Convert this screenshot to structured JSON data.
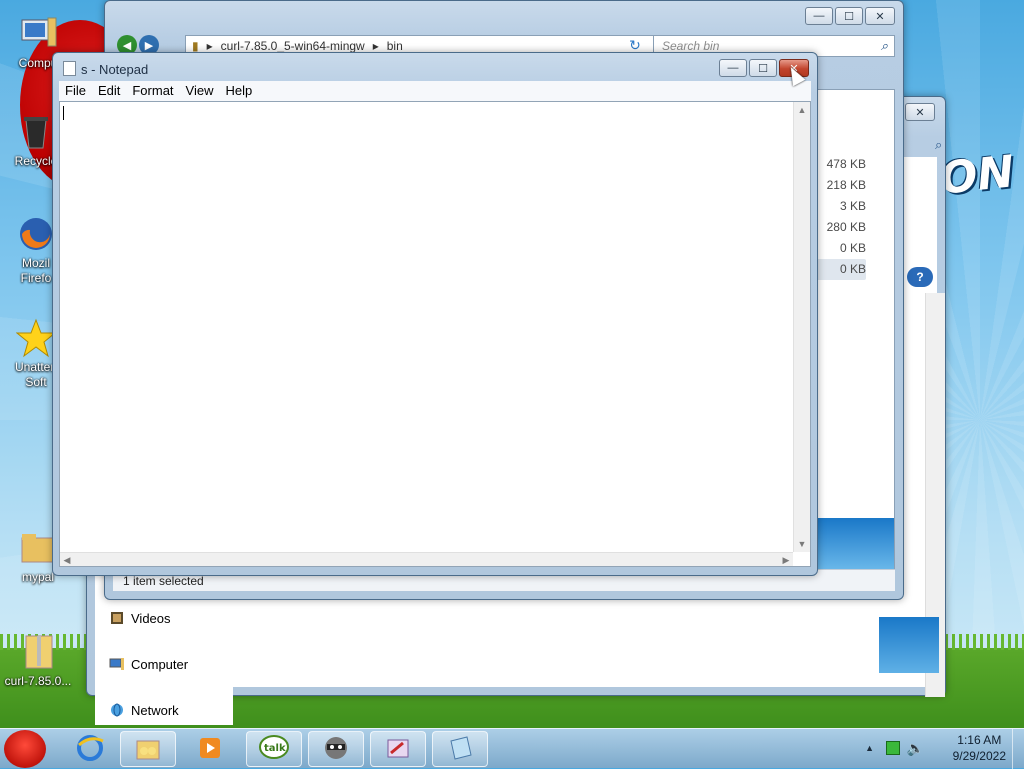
{
  "desktop": {
    "icons": [
      {
        "label": "Compu",
        "icon": "computer-icon"
      },
      {
        "label": "Recycle",
        "icon": "recycle-bin-icon"
      },
      {
        "label": "Mozil\nFirefo",
        "icon": "firefox-icon"
      },
      {
        "label": "Unatten\nSoft",
        "icon": "star-icon"
      },
      {
        "label": "mypal",
        "icon": "folder-icon"
      },
      {
        "label": "curl-7.85.0...",
        "icon": "zip-folder-icon"
      }
    ],
    "wallpaper_text": "ON"
  },
  "explorer": {
    "breadcrumb": [
      "curl-7.85.0_5-win64-mingw",
      "bin"
    ],
    "search_placeholder": "Search bin",
    "file_sizes": [
      "478 KB",
      "218 KB",
      "3 KB",
      "280 KB",
      "0 KB",
      "0 KB"
    ],
    "status": "1 item selected",
    "controls": {
      "minimize": "—",
      "maximize": "☐",
      "close": "✕"
    }
  },
  "explorer2": {
    "nav_items": [
      {
        "label": "Videos",
        "icon": "videos-icon"
      },
      {
        "label": "Computer",
        "icon": "computer-icon"
      },
      {
        "label": "Network",
        "icon": "network-icon"
      }
    ]
  },
  "notepad": {
    "title": "s - Notepad",
    "menu": [
      "File",
      "Edit",
      "Format",
      "View",
      "Help"
    ],
    "content": "",
    "controls": {
      "minimize": "—",
      "maximize": "☐",
      "close": "✕"
    }
  },
  "taskbar": {
    "buttons": [
      {
        "name": "internet-explorer-icon"
      },
      {
        "name": "windows-explorer-icon"
      },
      {
        "name": "media-player-icon"
      },
      {
        "name": "google-talk-icon"
      },
      {
        "name": "raccoon-app-icon"
      },
      {
        "name": "paint-app-icon"
      },
      {
        "name": "notepad-icon"
      }
    ],
    "clock": {
      "time": "1:16 AM",
      "date": "9/29/2022"
    }
  },
  "colors": {
    "close_hover": "#c2452e",
    "title_bar": "#c9daeb",
    "taskbar": "#78a5c8"
  }
}
